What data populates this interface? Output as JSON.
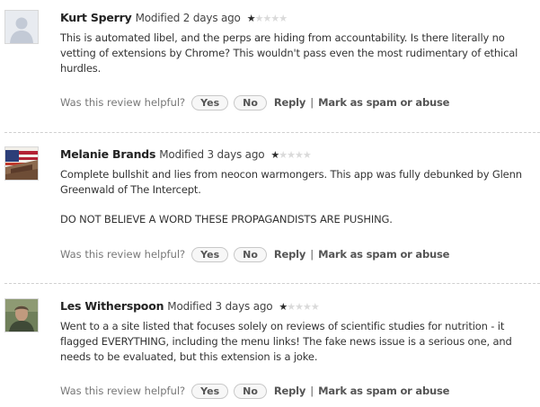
{
  "helpful_prompt": "Was this review helpful?",
  "yes_label": "Yes",
  "no_label": "No",
  "reply_label": "Reply",
  "separator": "|",
  "spam_label": "Mark as spam or abuse",
  "star_glyph": "★",
  "reviews": [
    {
      "author": "Kurt Sperry",
      "modified": "Modified 2 days ago",
      "rating": 1,
      "max_rating": 5,
      "avatar": "default-avatar",
      "paragraphs": [
        "This is automated libel, and the perps are hiding from accountability. Is there literally no vetting of extensions by Chrome? This wouldn't pass even the most rudimentary of ethical hurdles."
      ]
    },
    {
      "author": "Melanie Brands",
      "modified": "Modified 3 days ago",
      "rating": 1,
      "max_rating": 5,
      "avatar": "flag-photo-avatar",
      "paragraphs": [
        "Complete bullshit and lies from neocon warmongers. This app was fully debunked by Glenn Greenwald of The Intercept.",
        "DO NOT BELIEVE A WORD THESE PROPAGANDISTS ARE PUSHING."
      ]
    },
    {
      "author": "Les Witherspoon",
      "modified": "Modified 3 days ago",
      "rating": 1,
      "max_rating": 5,
      "avatar": "portrait-photo-avatar",
      "paragraphs": [
        "Went to a a site listed that focuses solely on reviews of scientific studies for nutrition - it flagged EVERYTHING, including the menu links! The fake news issue is a serious one, and needs to be evaluated, but this extension is a joke."
      ]
    }
  ]
}
